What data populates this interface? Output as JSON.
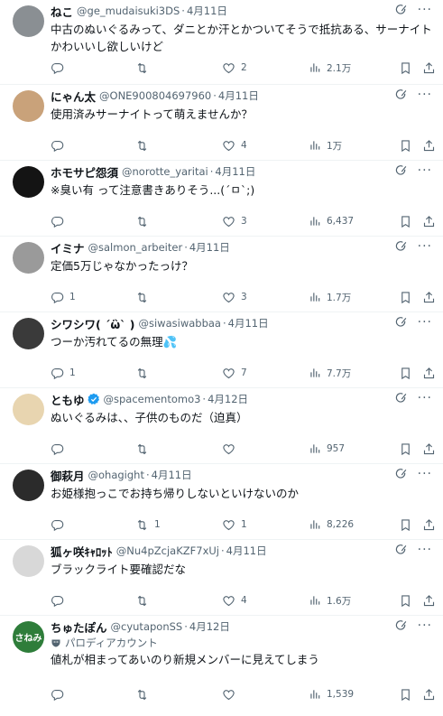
{
  "tweets": [
    {
      "name": "ねこ",
      "handle": "@ge_mudaisuki3DS",
      "date": "4月11日",
      "text": "中古のぬいぐるみって、ダニとか汗とかついてそうで抵抗ある、サーナイトかわいいし欲しいけど",
      "reply": "",
      "retweet": "",
      "like": "2",
      "views": "2.1万",
      "avatar_color": "#8a8f93"
    },
    {
      "name": "にゃん太",
      "handle": "@ONE900804697960",
      "date": "4月11日",
      "text": "使用済みサーナイトって萌えませんか？",
      "reply": "",
      "retweet": "",
      "like": "4",
      "views": "1万",
      "avatar_color": "#c9a27a"
    },
    {
      "name": "ホモサピ怨須",
      "handle": "@norotte_yaritai",
      "date": "4月11日",
      "text": "※臭い有 って注意書きありそう...(´ㅁ`;)",
      "reply": "",
      "retweet": "",
      "like": "3",
      "views": "6,437",
      "avatar_color": "#141414"
    },
    {
      "name": "イミナ",
      "handle": "@salmon_arbeiter",
      "date": "4月11日",
      "text": "定価5万じゃなかったっけ？",
      "reply": "1",
      "retweet": "",
      "like": "3",
      "views": "1.7万",
      "avatar_color": "#9a9a9a"
    },
    {
      "name": "シワシワ( ´ὢ` )",
      "handle": "@siwasiwabbaa",
      "date": "4月11日",
      "text": "つーか汚れてるの無理💦",
      "reply": "1",
      "retweet": "",
      "like": "7",
      "views": "7.7万",
      "avatar_color": "#3a3a3a"
    },
    {
      "name": "ともゆ",
      "handle": "@spacementomo3",
      "date": "4月12日",
      "text": "ぬいぐるみは、、子供のものだ（迫真）",
      "reply": "",
      "retweet": "",
      "like": "",
      "views": "957",
      "avatar_color": "#e8d5b0",
      "verified": true
    },
    {
      "name": "御萩月",
      "handle": "@ohagight",
      "date": "4月11日",
      "text": "お姫様抱っこでお持ち帰りしないといけないのか",
      "reply": "",
      "retweet": "1",
      "like": "1",
      "views": "8,226",
      "avatar_color": "#2b2b2b"
    },
    {
      "name": "狐ヶ咲ｷｬﾛｯﾄ",
      "handle": "@Nu4pZcjaKZF7xUj",
      "date": "4月11日",
      "text": "ブラックライト要確認だな",
      "reply": "",
      "retweet": "",
      "like": "4",
      "views": "1.6万",
      "avatar_color": "#d8d8d8"
    },
    {
      "name": "ちゅたぽん",
      "handle": "@cyutaponSS",
      "date": "4月12日",
      "label": "パロディアカウント",
      "text": "値札が相まってあいのり新規メンバーに見えてしまう",
      "reply": "",
      "retweet": "",
      "like": "",
      "views": "1,539",
      "avatar_color": "#2e7d3a",
      "avatar_text": "さねみ"
    }
  ],
  "colors": {
    "text": "#0f1419",
    "muted": "#536471",
    "border": "#eff3f4",
    "verified": "#1d9bf0"
  }
}
